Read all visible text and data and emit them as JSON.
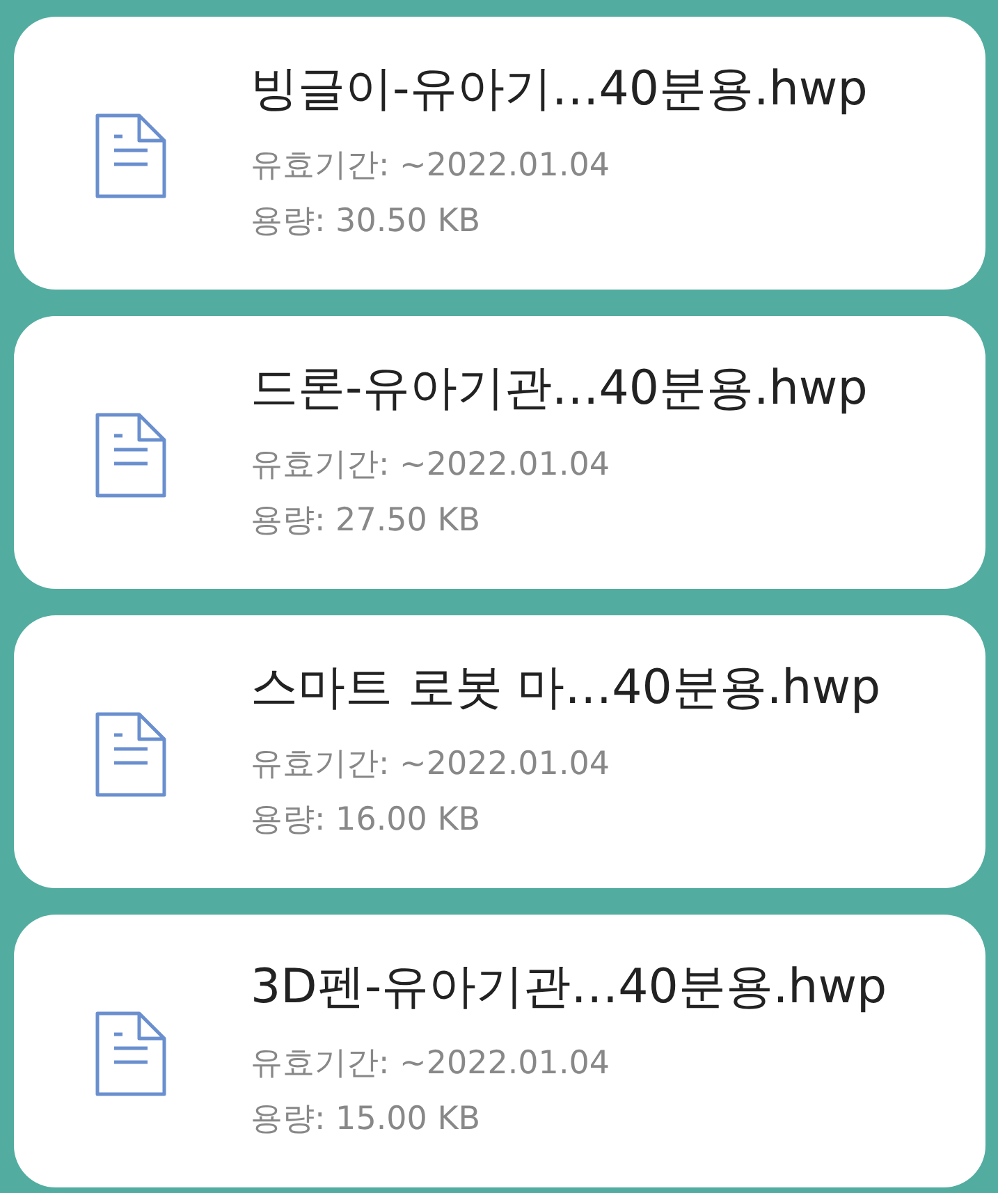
{
  "files": [
    {
      "name": "빙글이-유아기…40분용.hwp",
      "validity": "유효기간: ~2022.01.04",
      "size": "용량: 30.50 KB"
    },
    {
      "name": "드론-유아기관…40분용.hwp",
      "validity": "유효기간: ~2022.01.04",
      "size": "용량: 27.50 KB"
    },
    {
      "name": "스마트 로봇 마…40분용.hwp",
      "validity": "유효기간: ~2022.01.04",
      "size": "용량: 16.00 KB"
    },
    {
      "name": "3D펜-유아기관…40분용.hwp",
      "validity": "유효기간: ~2022.01.04",
      "size": "용량: 15.00 KB"
    }
  ]
}
